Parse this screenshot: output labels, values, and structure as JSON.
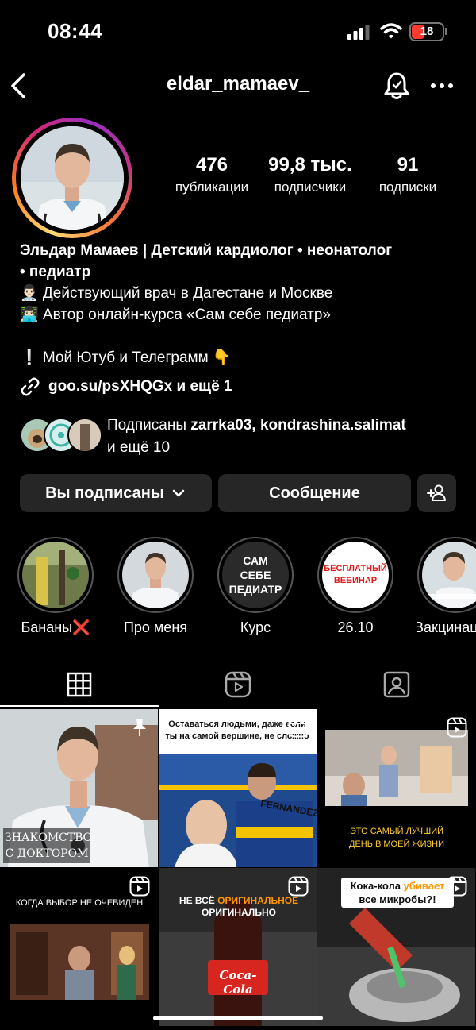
{
  "status": {
    "time": "08:44",
    "battery": "18"
  },
  "nav": {
    "title": "eldar_mamaev_"
  },
  "stats": [
    {
      "value": "476",
      "label": "публикации"
    },
    {
      "value": "99,8 тыс.",
      "label": "подписчики"
    },
    {
      "value": "91",
      "label": "подписки"
    }
  ],
  "bio": {
    "name_line1": "Эльдар Мамаев | Детский кардиолог • неонатолог",
    "name_line2": "• педиатр",
    "line1": "👨🏻‍⚕️ Действующий врач в Дагестане и Москве",
    "line2": "👨🏻‍💻 Автор онлайн-курса «Сам себе педиатр»",
    "line3": "❕ Мой Ютуб и Телеграмм 👇",
    "link": "goo.su/psXHQGx и ещё 1"
  },
  "followed_by": {
    "prefix": "Подписаны",
    "user1": "zarrka03",
    "sep": ",",
    "user2": "kondrashina.salimat",
    "suffix": "и ещё 10"
  },
  "actions": {
    "following": "Вы подписаны",
    "message": "Сообщение"
  },
  "highlights": [
    {
      "label": "Бананы❌"
    },
    {
      "label": "Про меня"
    },
    {
      "label": "Курс",
      "cover_text": "САМ СЕБЕ ПЕДИАТР"
    },
    {
      "label": "26.10",
      "cover_text": "БЕСПЛАТНЫЙ ВЕБИНАР"
    },
    {
      "label": "Вакцинация"
    }
  ],
  "grid": [
    {
      "caption": "ЗНАКОМСТВО С ДОКТОРОМ"
    },
    {
      "caption": "Оставаться людьми, даже если ты на самой вершине, не сложно",
      "jersey": "FERNANDEZ"
    },
    {
      "caption": "ЭТО САМЫЙ ЛУЧШИЙ ДЕНЬ В МОЕЙ ЖИЗНИ"
    },
    {
      "caption": "КОГДА ВЫБОР НЕ ОЧЕВИДЕН"
    },
    {
      "caption_a": "НЕ ВСЁ",
      "caption_b": "ОРИГИНАЛЬНОЕ",
      "caption_c": "ОРИГИНАЛЬНО",
      "bottle_text": "Coca-Cola"
    },
    {
      "caption_a": "Кока-кола",
      "caption_b": "убивает",
      "caption_c": "все микробы?!"
    }
  ],
  "colors": {
    "accent_red": "#ff3b30",
    "button_bg": "#262626",
    "highlight_orange": "#ff9500"
  }
}
